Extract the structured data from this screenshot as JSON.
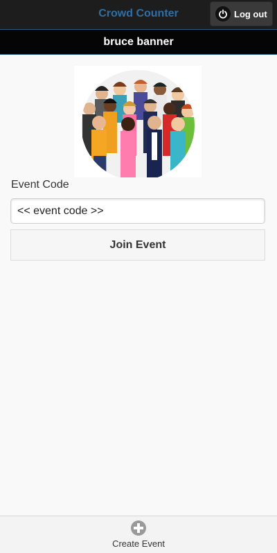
{
  "header": {
    "title": "Crowd Counter",
    "logout_label": "Log out",
    "logout_icon": "power-icon"
  },
  "subheader": {
    "user_name": "bruce banner"
  },
  "main": {
    "image_icon": "crowd-illustration",
    "event_code_label": "Event Code",
    "event_code_placeholder": "<< event code >>",
    "join_label": "Join Event"
  },
  "footer": {
    "create_label": "Create Event",
    "create_icon": "plus-circle-icon"
  },
  "colors": {
    "header_bg": "#1d1d1d",
    "title": "#2f6fa6",
    "subheader_bg": "#050505",
    "page_bg": "#f9f9f9"
  }
}
